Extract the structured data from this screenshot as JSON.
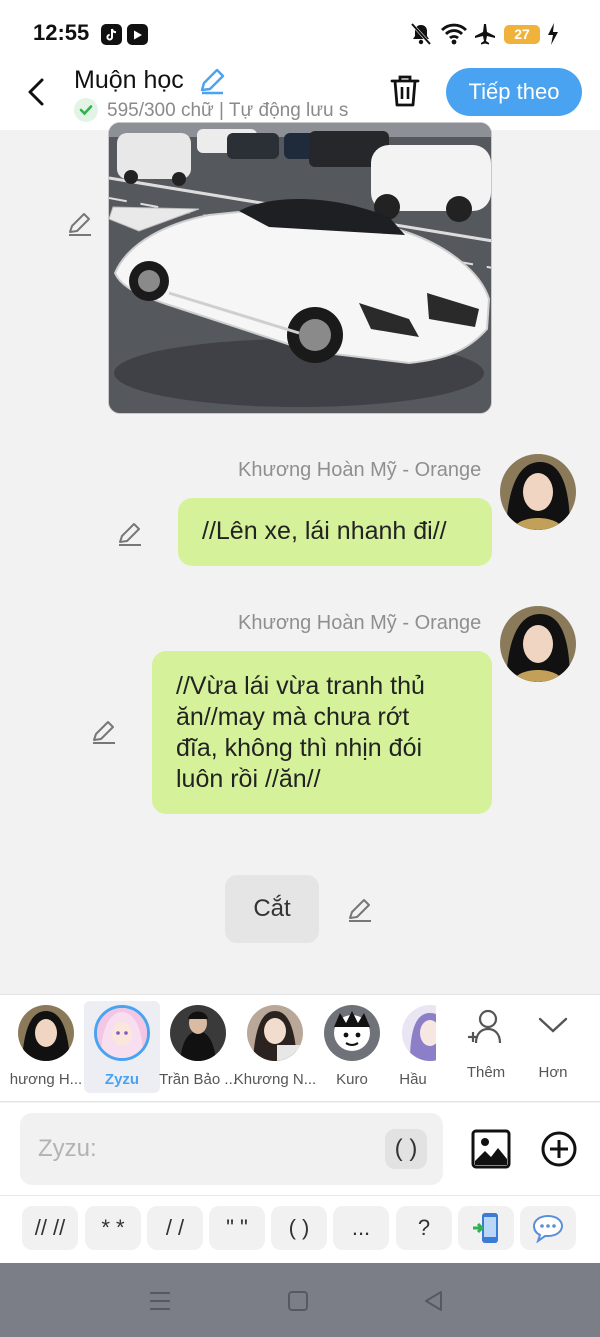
{
  "status_bar": {
    "time": "12:55",
    "app_icons": [
      "tiktok-icon",
      "youtube-icon"
    ],
    "system_icons": [
      "mute-icon",
      "wifi-icon",
      "airplane-icon",
      "battery-icon",
      "charging-icon"
    ],
    "battery_level": "27"
  },
  "header": {
    "title": "Muộn học",
    "save_status": "595/300 chữ | Tự động lưu s",
    "next_label": "Tiếp theo"
  },
  "messages": [
    {
      "sender": "Khương Hoàn Mỹ - Orange",
      "text": "//Lên xe, lái nhanh đi//"
    },
    {
      "sender": "Khương Hoàn Mỹ - Orange",
      "text_lines": [
        "//Vừa lái vừa tranh thủ",
        "ăn//may mà chưa rớt",
        "đĩa, không thì nhịn đói",
        "luôn rồi //ăn//"
      ]
    }
  ],
  "narration": "Cắt",
  "characters": [
    {
      "name": "hương H..."
    },
    {
      "name": "Zyzu",
      "selected": true
    },
    {
      "name": "Trần Bảo ..."
    },
    {
      "name": "Khương N..."
    },
    {
      "name": "Kuro"
    },
    {
      "name": "Hầu"
    }
  ],
  "tools": {
    "add_label": "Thêm",
    "more_label": "Hơn"
  },
  "composer": {
    "placeholder": "Zyzu:",
    "paren_label": "( )"
  },
  "symbols": [
    "// //",
    "* *",
    "/ /",
    "\" \"",
    "( )",
    "...",
    "?"
  ],
  "colors": {
    "accent": "#4aa3f1",
    "bubble": "#d5f29a",
    "battery": "#f0b23a"
  }
}
